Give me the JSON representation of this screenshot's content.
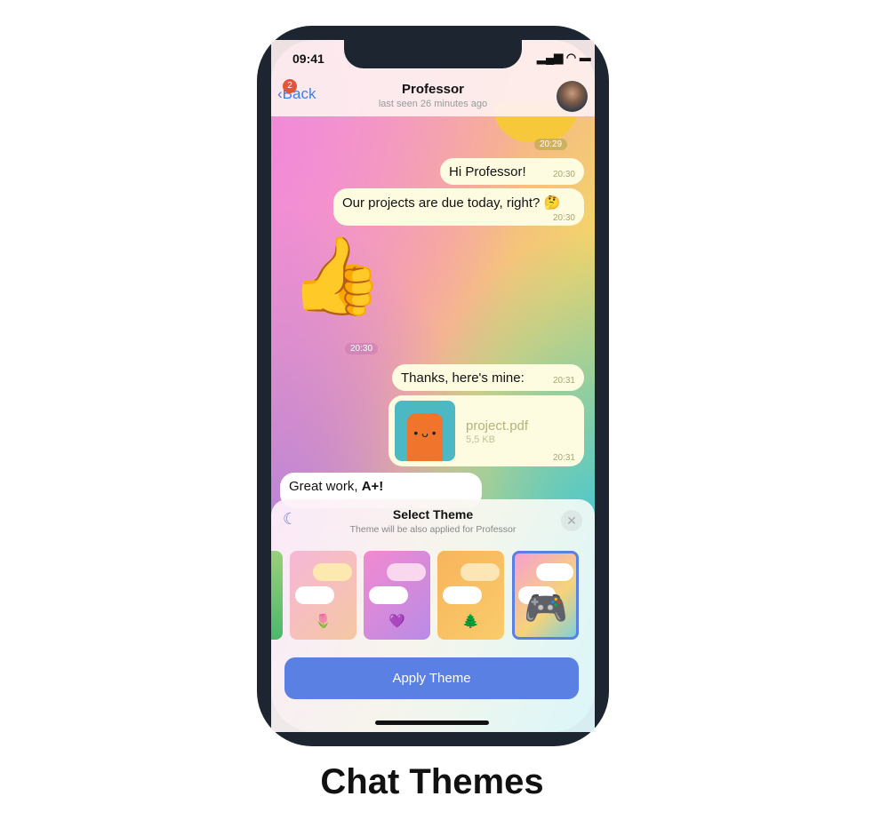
{
  "status": {
    "time": "09:41"
  },
  "nav": {
    "back_label": "Back",
    "badge": "2",
    "title": "Professor",
    "subtitle": "last seen 26 minutes ago"
  },
  "messages": [
    {
      "time": "20:29"
    },
    {
      "text": "Hi Professor!",
      "time": "20:30"
    },
    {
      "text": "Our projects are due today, right? 🤔",
      "time": "20:30"
    },
    {
      "sticker": "👍",
      "time": "20:30"
    },
    {
      "text": "Thanks, here's mine:",
      "time": "20:31"
    },
    {
      "file_name": "project.pdf",
      "file_size": "5,5 KB",
      "time": "20:31"
    },
    {
      "text_plain": "Great work, ",
      "text_bold": "A+!"
    }
  ],
  "sheet": {
    "title": "Select Theme",
    "subtitle": "Theme will be also applied for Professor",
    "themes": [
      {
        "emoji": "🌷"
      },
      {
        "emoji": "💜"
      },
      {
        "emoji": "🌲"
      },
      {
        "emoji": "🎮",
        "selected": true
      }
    ],
    "apply_label": "Apply Theme",
    "accent": "#5b80e3"
  },
  "caption": "Chat Themes"
}
